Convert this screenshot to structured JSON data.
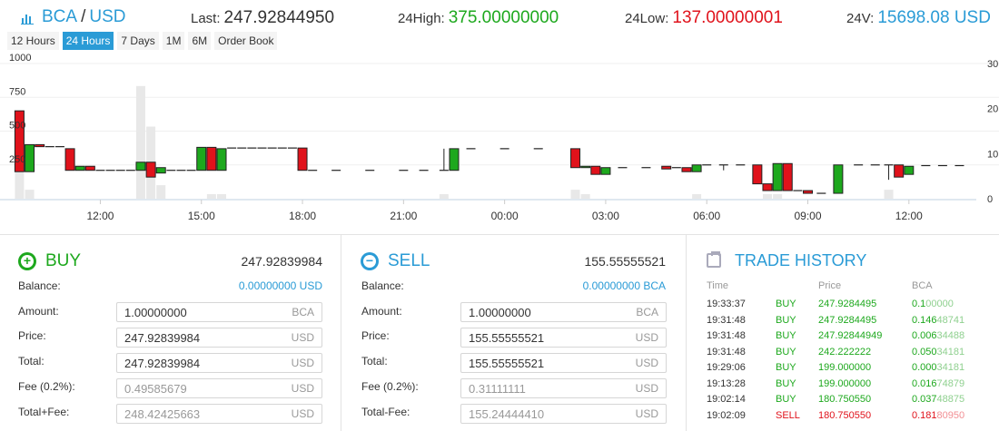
{
  "header": {
    "base": "BCA",
    "slash": "/",
    "quote": "USD",
    "last_label": "Last:",
    "last_value": "247.92844950",
    "high_label": "24High:",
    "high_value": "375.00000000",
    "low_label": "24Low:",
    "low_value": "137.00000001",
    "vol_label": "24V:",
    "vol_value": "15698.08 USD",
    "icon": "bar-chart-icon"
  },
  "ranges": [
    {
      "label": "12 Hours",
      "active": false
    },
    {
      "label": "24 Hours",
      "active": true
    },
    {
      "label": "7 Days",
      "active": false
    },
    {
      "label": "1M",
      "active": false
    },
    {
      "label": "6M",
      "active": false
    },
    {
      "label": "Order Book",
      "active": false
    }
  ],
  "colors": {
    "up": "#1da81d",
    "down": "#e0121b",
    "accent": "#2a9bd6"
  },
  "chart_data": {
    "type": "candlestick",
    "left_ticks": [
      "1000",
      "750",
      "500",
      "250"
    ],
    "right_ticks": [
      "30",
      "20",
      "10",
      "0"
    ],
    "ylim": [
      0,
      1000
    ],
    "vol_lim": [
      0,
      30
    ],
    "x_ticks": [
      {
        "label": "12:00",
        "t": 12
      },
      {
        "label": "15:00",
        "t": 15
      },
      {
        "label": "18:00",
        "t": 18
      },
      {
        "label": "21:00",
        "t": 21
      },
      {
        "label": "00:00",
        "t": 24
      },
      {
        "label": "03:00",
        "t": 27
      },
      {
        "label": "06:00",
        "t": 30
      },
      {
        "label": "09:00",
        "t": 33
      },
      {
        "label": "12:00",
        "t": 36
      }
    ],
    "candles": [
      {
        "t": 9.6,
        "o": 650,
        "c": 200,
        "h": 650,
        "l": 200
      },
      {
        "t": 9.9,
        "o": 200,
        "c": 400,
        "h": 400,
        "l": 200
      },
      {
        "t": 10.2,
        "o": 400,
        "c": 385,
        "h": 400,
        "l": 385
      },
      {
        "t": 10.5,
        "o": 385,
        "c": 385,
        "h": 385,
        "l": 385
      },
      {
        "t": 10.8,
        "o": 385,
        "c": 385,
        "h": 385,
        "l": 385
      },
      {
        "t": 11.1,
        "o": 370,
        "c": 210,
        "h": 370,
        "l": 210
      },
      {
        "t": 11.4,
        "o": 210,
        "c": 240,
        "h": 240,
        "l": 210
      },
      {
        "t": 11.7,
        "o": 240,
        "c": 210,
        "h": 240,
        "l": 210
      },
      {
        "t": 12.0,
        "o": 210,
        "c": 210,
        "h": 210,
        "l": 210
      },
      {
        "t": 12.3,
        "o": 210,
        "c": 210,
        "h": 210,
        "l": 210
      },
      {
        "t": 12.6,
        "o": 210,
        "c": 210,
        "h": 210,
        "l": 210
      },
      {
        "t": 12.9,
        "o": 210,
        "c": 210,
        "h": 210,
        "l": 210
      },
      {
        "t": 13.2,
        "o": 210,
        "c": 270,
        "h": 270,
        "l": 210
      },
      {
        "t": 13.5,
        "o": 270,
        "c": 160,
        "h": 270,
        "l": 160
      },
      {
        "t": 13.8,
        "o": 190,
        "c": 230,
        "h": 230,
        "l": 190
      },
      {
        "t": 14.1,
        "o": 210,
        "c": 210,
        "h": 210,
        "l": 210
      },
      {
        "t": 14.4,
        "o": 210,
        "c": 210,
        "h": 210,
        "l": 210
      },
      {
        "t": 14.7,
        "o": 210,
        "c": 210,
        "h": 210,
        "l": 210
      },
      {
        "t": 15.0,
        "o": 210,
        "c": 380,
        "h": 380,
        "l": 210
      },
      {
        "t": 15.3,
        "o": 380,
        "c": 210,
        "h": 380,
        "l": 210
      },
      {
        "t": 15.6,
        "o": 210,
        "c": 370,
        "h": 370,
        "l": 210
      },
      {
        "t": 15.9,
        "o": 375,
        "c": 375,
        "h": 375,
        "l": 375
      },
      {
        "t": 16.2,
        "o": 375,
        "c": 375,
        "h": 375,
        "l": 375
      },
      {
        "t": 16.5,
        "o": 375,
        "c": 375,
        "h": 375,
        "l": 375
      },
      {
        "t": 16.8,
        "o": 375,
        "c": 375,
        "h": 375,
        "l": 375
      },
      {
        "t": 17.1,
        "o": 375,
        "c": 375,
        "h": 375,
        "l": 375
      },
      {
        "t": 17.4,
        "o": 375,
        "c": 375,
        "h": 375,
        "l": 375
      },
      {
        "t": 17.7,
        "o": 375,
        "c": 375,
        "h": 375,
        "l": 375
      },
      {
        "t": 18.0,
        "o": 375,
        "c": 210,
        "h": 375,
        "l": 210
      },
      {
        "t": 18.3,
        "o": 210,
        "c": 210,
        "h": 210,
        "l": 210
      },
      {
        "t": 19.0,
        "o": 210,
        "c": 210,
        "h": 210,
        "l": 210
      },
      {
        "t": 20.0,
        "o": 210,
        "c": 210,
        "h": 210,
        "l": 210
      },
      {
        "t": 21.0,
        "o": 210,
        "c": 210,
        "h": 210,
        "l": 210
      },
      {
        "t": 21.6,
        "o": 210,
        "c": 210,
        "h": 210,
        "l": 210
      },
      {
        "t": 22.2,
        "o": 210,
        "c": 210,
        "h": 370,
        "l": 210
      },
      {
        "t": 22.5,
        "o": 210,
        "c": 370,
        "h": 370,
        "l": 210
      },
      {
        "t": 23.0,
        "o": 370,
        "c": 370,
        "h": 370,
        "l": 370
      },
      {
        "t": 24.0,
        "o": 370,
        "c": 370,
        "h": 370,
        "l": 370
      },
      {
        "t": 25.0,
        "o": 370,
        "c": 370,
        "h": 370,
        "l": 370
      },
      {
        "t": 26.1,
        "o": 370,
        "c": 230,
        "h": 370,
        "l": 230
      },
      {
        "t": 26.4,
        "o": 230,
        "c": 240,
        "h": 240,
        "l": 230
      },
      {
        "t": 26.7,
        "o": 240,
        "c": 180,
        "h": 240,
        "l": 180
      },
      {
        "t": 27.0,
        "o": 180,
        "c": 230,
        "h": 230,
        "l": 180
      },
      {
        "t": 27.5,
        "o": 230,
        "c": 230,
        "h": 230,
        "l": 230
      },
      {
        "t": 28.2,
        "o": 230,
        "c": 230,
        "h": 230,
        "l": 230
      },
      {
        "t": 28.8,
        "o": 240,
        "c": 220,
        "h": 240,
        "l": 220
      },
      {
        "t": 29.1,
        "o": 230,
        "c": 230,
        "h": 230,
        "l": 230
      },
      {
        "t": 29.4,
        "o": 230,
        "c": 200,
        "h": 230,
        "l": 200
      },
      {
        "t": 29.7,
        "o": 200,
        "c": 250,
        "h": 250,
        "l": 200
      },
      {
        "t": 30.0,
        "o": 250,
        "c": 250,
        "h": 250,
        "l": 250
      },
      {
        "t": 30.5,
        "o": 250,
        "c": 250,
        "h": 250,
        "l": 210
      },
      {
        "t": 31.0,
        "o": 250,
        "c": 250,
        "h": 250,
        "l": 250
      },
      {
        "t": 31.5,
        "o": 250,
        "c": 110,
        "h": 250,
        "l": 110
      },
      {
        "t": 31.8,
        "o": 110,
        "c": 60,
        "h": 110,
        "l": 60
      },
      {
        "t": 32.1,
        "o": 60,
        "c": 260,
        "h": 260,
        "l": 60
      },
      {
        "t": 32.4,
        "o": 260,
        "c": 60,
        "h": 260,
        "l": 60
      },
      {
        "t": 32.7,
        "o": 60,
        "c": 60,
        "h": 60,
        "l": 60
      },
      {
        "t": 33.0,
        "o": 60,
        "c": 40,
        "h": 60,
        "l": 40
      },
      {
        "t": 33.4,
        "o": 40,
        "c": 40,
        "h": 40,
        "l": 40
      },
      {
        "t": 33.9,
        "o": 40,
        "c": 250,
        "h": 250,
        "l": 40
      },
      {
        "t": 34.5,
        "o": 250,
        "c": 250,
        "h": 250,
        "l": 250
      },
      {
        "t": 35.0,
        "o": 250,
        "c": 250,
        "h": 250,
        "l": 250
      },
      {
        "t": 35.4,
        "o": 250,
        "c": 250,
        "h": 250,
        "l": 140
      },
      {
        "t": 35.7,
        "o": 250,
        "c": 160,
        "h": 250,
        "l": 160
      },
      {
        "t": 36.0,
        "o": 180,
        "c": 240,
        "h": 240,
        "l": 180
      },
      {
        "t": 36.5,
        "o": 245,
        "c": 245,
        "h": 245,
        "l": 245
      },
      {
        "t": 37.0,
        "o": 245,
        "c": 245,
        "h": 245,
        "l": 245
      },
      {
        "t": 37.5,
        "o": 245,
        "c": 245,
        "h": 245,
        "l": 245
      }
    ],
    "volumes": [
      {
        "t": 9.6,
        "v": 14
      },
      {
        "t": 9.9,
        "v": 2
      },
      {
        "t": 13.2,
        "v": 25
      },
      {
        "t": 13.5,
        "v": 16
      },
      {
        "t": 13.8,
        "v": 3
      },
      {
        "t": 15.3,
        "v": 1
      },
      {
        "t": 15.6,
        "v": 1
      },
      {
        "t": 22.2,
        "v": 1
      },
      {
        "t": 26.1,
        "v": 2
      },
      {
        "t": 26.4,
        "v": 1
      },
      {
        "t": 29.7,
        "v": 1
      },
      {
        "t": 31.8,
        "v": 1
      },
      {
        "t": 32.1,
        "v": 1
      },
      {
        "t": 35.4,
        "v": 2
      }
    ]
  },
  "buy": {
    "title": "BUY",
    "price": "247.92839984",
    "balance_label": "Balance:",
    "balance_value": "0.00000000 USD",
    "amount_label": "Amount:",
    "amount_value": "1.00000000",
    "amount_unit": "BCA",
    "price_label": "Price:",
    "price_value": "247.92839984",
    "price_unit": "USD",
    "total_label": "Total:",
    "total_value": "247.92839984",
    "total_unit": "USD",
    "fee_label": "Fee (0.2%):",
    "fee_value": "0.49585679",
    "fee_unit": "USD",
    "totalfee_label": "Total+Fee:",
    "totalfee_value": "248.42425663",
    "totalfee_unit": "USD"
  },
  "sell": {
    "title": "SELL",
    "price": "155.55555521",
    "balance_label": "Balance:",
    "balance_value": "0.00000000 BCA",
    "amount_label": "Amount:",
    "amount_value": "1.00000000",
    "amount_unit": "BCA",
    "price_label": "Price:",
    "price_value": "155.55555521",
    "price_unit": "USD",
    "total_label": "Total:",
    "total_value": "155.55555521",
    "total_unit": "USD",
    "fee_label": "Fee (0.2%):",
    "fee_value": "0.31111111",
    "fee_unit": "USD",
    "totalfee_label": "Total-Fee:",
    "totalfee_value": "155.24444410",
    "totalfee_unit": "USD"
  },
  "history": {
    "title": "TRADE HISTORY",
    "col_time": "Time",
    "col_price": "Price",
    "col_bca": "BCA",
    "rows": [
      {
        "time": "19:33:37",
        "side": "BUY",
        "price": "247.9284495",
        "bca_a": "0.1",
        "bca_b": "00000"
      },
      {
        "time": "19:31:48",
        "side": "BUY",
        "price": "247.9284495",
        "bca_a": "0.146",
        "bca_b": "48741"
      },
      {
        "time": "19:31:48",
        "side": "BUY",
        "price": "247.92844949",
        "bca_a": "0.006",
        "bca_b": "34488"
      },
      {
        "time": "19:31:48",
        "side": "BUY",
        "price": "242.222222",
        "bca_a": "0.050",
        "bca_b": "34181"
      },
      {
        "time": "19:29:06",
        "side": "BUY",
        "price": "199.000000",
        "bca_a": "0.000",
        "bca_b": "34181"
      },
      {
        "time": "19:13:28",
        "side": "BUY",
        "price": "199.000000",
        "bca_a": "0.016",
        "bca_b": "74879"
      },
      {
        "time": "19:02:14",
        "side": "BUY",
        "price": "180.750550",
        "bca_a": "0.037",
        "bca_b": "48875"
      },
      {
        "time": "19:02:09",
        "side": "SELL",
        "price": "180.750550",
        "bca_a": "0.181",
        "bca_b": "80950"
      }
    ]
  }
}
